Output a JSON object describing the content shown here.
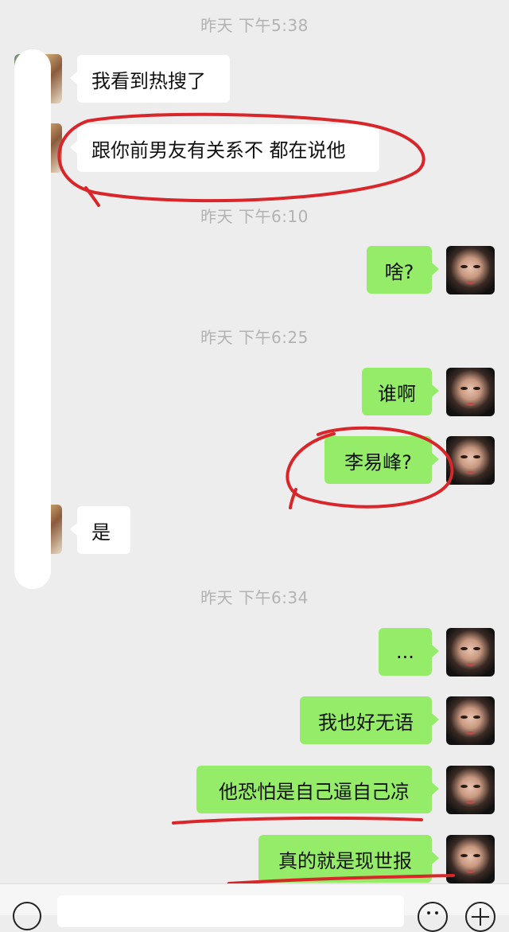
{
  "timestamps": [
    "昨天 下午5:38",
    "昨天 下午6:10",
    "昨天 下午6:25",
    "昨天 下午6:34"
  ],
  "messages": [
    {
      "side": "in",
      "text": "我看到热搜了"
    },
    {
      "side": "in",
      "text": "跟你前男友有关系不 都在说他"
    },
    {
      "side": "out",
      "text": "啥?"
    },
    {
      "side": "out",
      "text": "谁啊"
    },
    {
      "side": "out",
      "text": "李易峰?"
    },
    {
      "side": "in",
      "text": "是"
    },
    {
      "side": "out",
      "text": "..."
    },
    {
      "side": "out",
      "text": "我也好无语"
    },
    {
      "side": "out",
      "text": "他恐怕是自己逼自己凉"
    },
    {
      "side": "out",
      "text": "真的就是现世报"
    }
  ],
  "colors": {
    "background": "#ededed",
    "incoming_bubble": "#ffffff",
    "outgoing_bubble": "#95ec69",
    "timestamp_text": "#b2b2b2",
    "annotation_ink": "#d8262a"
  },
  "input_bar": {
    "icons": [
      "voice-icon",
      "emoji-icon",
      "plus-icon"
    ]
  }
}
